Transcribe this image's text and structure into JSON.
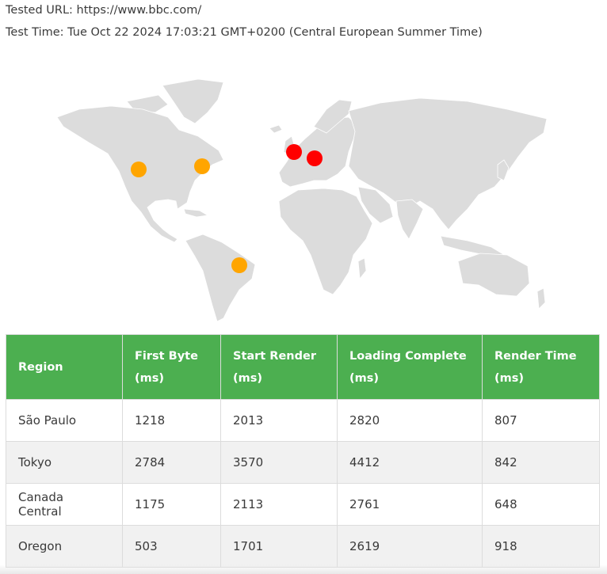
{
  "header": {
    "tested_url": "Tested URL: https://www.bbc.com/",
    "test_time": "Test Time: Tue Oct 22 2024 17:03:21 GMT+0200 (Central European Summer Time)"
  },
  "map": {
    "land_color": "#dcdcdc",
    "markers": [
      {
        "name": "oregon",
        "color": "#ffa500"
      },
      {
        "name": "canada-central",
        "color": "#ffa500"
      },
      {
        "name": "sao-paulo",
        "color": "#ffa500"
      },
      {
        "name": "london",
        "color": "#ff0000"
      },
      {
        "name": "frankfurt",
        "color": "#ff0000"
      }
    ]
  },
  "table": {
    "header_color": "#4caf50",
    "columns": [
      {
        "line1": "Region",
        "line2": ""
      },
      {
        "line1": "First Byte",
        "line2": "(ms)"
      },
      {
        "line1": "Start Render",
        "line2": "(ms)"
      },
      {
        "line1": "Loading Complete",
        "line2": "(ms)"
      },
      {
        "line1": "Render Time",
        "line2": "(ms)"
      }
    ],
    "rows": [
      [
        "São Paulo",
        "1218",
        "2013",
        "2820",
        "807"
      ],
      [
        "Tokyo",
        "2784",
        "3570",
        "4412",
        "842"
      ],
      [
        "Canada Central",
        "1175",
        "2113",
        "2761",
        "648"
      ],
      [
        "Oregon",
        "503",
        "1701",
        "2619",
        "918"
      ]
    ]
  }
}
